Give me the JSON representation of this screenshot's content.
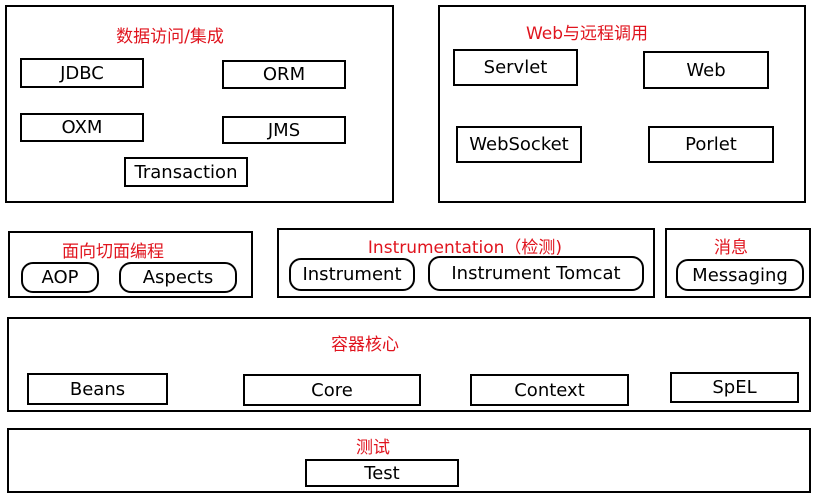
{
  "groups": {
    "data_access": {
      "title": "数据访问/集成",
      "modules": [
        "JDBC",
        "ORM",
        "OXM",
        "JMS",
        "Transaction"
      ]
    },
    "web": {
      "title": "Web与远程调用",
      "modules": [
        "Servlet",
        "Web",
        "WebSocket",
        "Porlet"
      ]
    },
    "aop": {
      "title": "面向切面编程",
      "modules": [
        "AOP",
        "Aspects"
      ]
    },
    "instrumentation": {
      "title": "Instrumentation（检测)",
      "modules": [
        "Instrument",
        "Instrument Tomcat"
      ]
    },
    "messaging": {
      "title": "消息",
      "modules": [
        "Messaging"
      ]
    },
    "core_container": {
      "title": "容器核心",
      "modules": [
        "Beans",
        "Core",
        "Context",
        "SpEL"
      ]
    },
    "test": {
      "title": "测试",
      "modules": [
        "Test"
      ]
    }
  },
  "colors": {
    "title": "#e0141e",
    "border": "#000000"
  }
}
